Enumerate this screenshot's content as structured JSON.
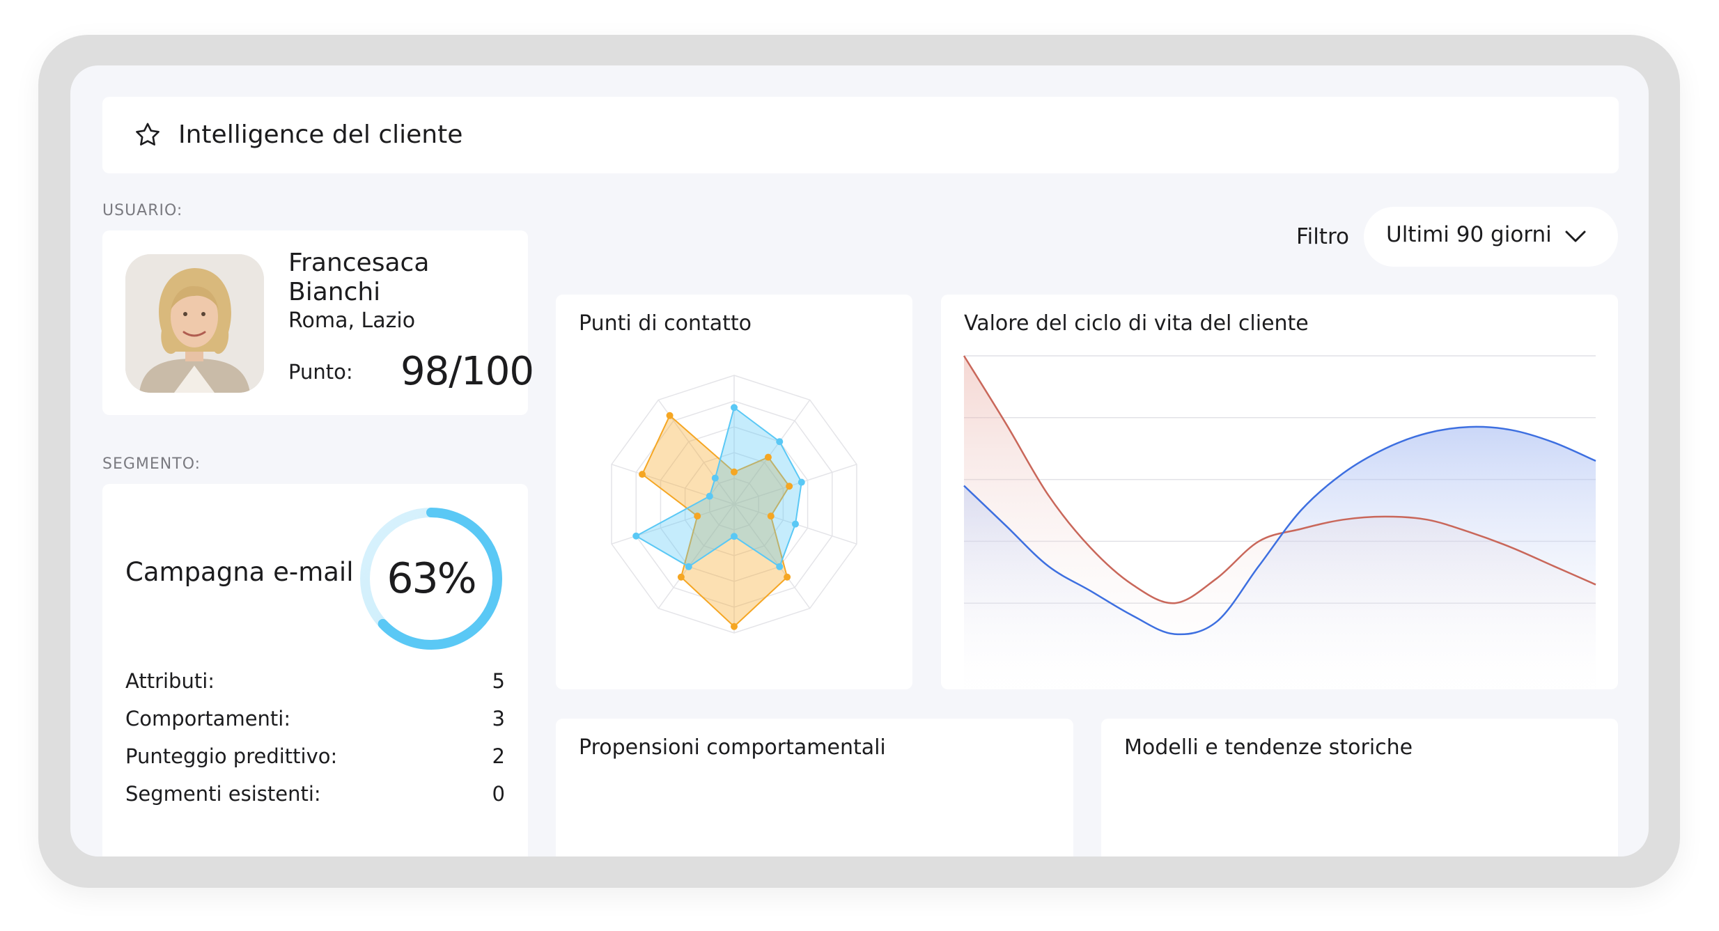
{
  "header": {
    "title": "Intelligence del cliente",
    "icon": "star-icon"
  },
  "user_section": {
    "label": "USUARIO:"
  },
  "user": {
    "name": "Francesaca Bianchi",
    "location": "Roma, Lazio",
    "score_label": "Punto:",
    "score": "98/100"
  },
  "segment_section": {
    "label": "SEGMENTO:"
  },
  "segment": {
    "title": "Campagna e-mail",
    "percent": "63%",
    "progress": 0.63,
    "ring_color": "#5ac8f5",
    "rows": [
      {
        "label": "Attributi:",
        "value": "5"
      },
      {
        "label": "Comportamenti:",
        "value": "3"
      },
      {
        "label": "Punteggio predittivo:",
        "value": "2"
      },
      {
        "label": "Segmenti esistenti:",
        "value": "0"
      }
    ]
  },
  "filter": {
    "label": "Filtro",
    "selected": "Ultimi 90 giorni",
    "icon": "chevron-down-icon"
  },
  "cards": {
    "radar_title": "Punti di contatto",
    "ltv_title": "Valore del ciclo di vita del cliente",
    "propensity_title": "Propensioni comportamentali",
    "trends_title": "Modelli e tendenze storiche"
  },
  "colors": {
    "blue": "#5ac8f5",
    "orange": "#f5a623",
    "red_line": "#c9675a",
    "blue_line": "#3d6fe0"
  },
  "chart_data": [
    {
      "type": "radar",
      "axes": 10,
      "max": 1,
      "series": [
        {
          "color": "#5ac8f5",
          "values": [
            0.75,
            0.6,
            0.55,
            0.5,
            0.6,
            0.25,
            0.6,
            0.8,
            0.2,
            0.25
          ]
        },
        {
          "color": "#f5a623",
          "values": [
            0.25,
            0.45,
            0.45,
            0.3,
            0.7,
            0.95,
            0.7,
            0.3,
            0.75,
            0.85
          ]
        }
      ]
    },
    {
      "type": "area",
      "grid": true,
      "ylim": [
        0,
        100
      ],
      "series": [
        {
          "color": "#c9675a",
          "values": [
            100,
            78,
            55,
            38,
            26,
            20,
            28,
            40,
            44,
            47,
            48,
            47,
            43,
            38,
            32,
            26
          ]
        },
        {
          "color": "#3d6fe0",
          "values": [
            58,
            45,
            32,
            24,
            16,
            10,
            14,
            32,
            50,
            62,
            70,
            75,
            77,
            76,
            72,
            66
          ]
        }
      ]
    }
  ]
}
